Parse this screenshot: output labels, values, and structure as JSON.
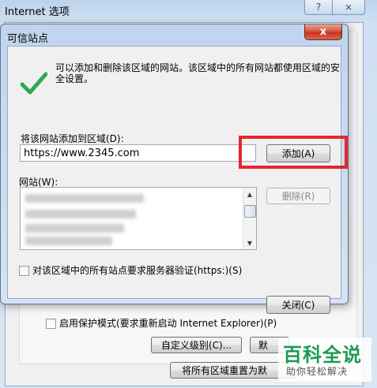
{
  "parent_window": {
    "title": "Internet 选项",
    "help_label": "?",
    "close_label": "⨯",
    "protected_mode_label": "启用保护模式(要求重新启动 Internet Explorer)(P)",
    "custom_level_label": "自定义级别(C)...",
    "default_level_label": "默",
    "reset_all_label": "将所有区域重置为默"
  },
  "dialog": {
    "title": "可信站点",
    "close_label": "x",
    "info_text": "可以添加和删除该区域的网站。该区域中的所有网站都使用区域的安全设置。",
    "add_site_label": "将该网站添加到区域(D):",
    "url_value": "https://www.2345.com",
    "add_button": "添加(A)",
    "sites_label": "网站(W):",
    "remove_button": "删除(R)",
    "require_https_label": "对该区域中的所有站点要求服务器验证(https:)(S)",
    "close_button": "关闭(C)",
    "check_color": "#2fa84f",
    "highlight_color": "#e5262e"
  },
  "watermark": {
    "main": "百科全说",
    "sub": "助你轻松解决"
  }
}
